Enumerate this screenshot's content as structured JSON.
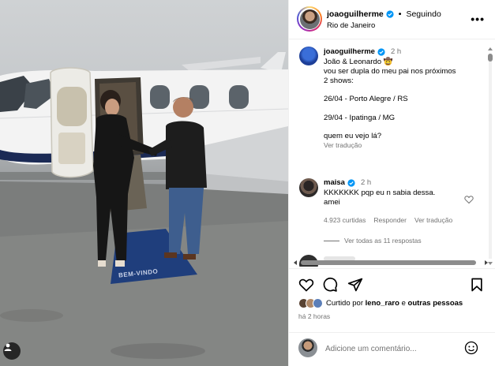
{
  "header": {
    "username": "joaoguilherme",
    "separator": "•",
    "follow_status": "Seguindo",
    "location": "Rio de Janeiro",
    "more": "•••"
  },
  "caption": {
    "username": "joaoguilherme",
    "time": "2 h",
    "lines": [
      "João & Leonardo 🤠",
      "vou ser dupla do meu pai nos próximos",
      "2 shows:",
      "",
      "26/04 - Porto Alegre / RS",
      "",
      "29/04 - Ipatinga / MG",
      "",
      "quem eu vejo lá?"
    ],
    "see_translation": "Ver tradução"
  },
  "comment": {
    "username": "maisa",
    "time": "2 h",
    "text_line1": "KKKKKKK pqp eu n sabia dessa.",
    "text_line2": "amei",
    "likes": "4.923 curtidas",
    "reply": "Responder",
    "see_translation": "Ver tradução",
    "view_replies": "Ver todas as 11 respostas"
  },
  "footer": {
    "liked_by_prefix": "Curtido por",
    "liked_by_user": "leno_raro",
    "liked_by_and": "e",
    "liked_by_others": "outras pessoas",
    "time_ago": "há 2 horas",
    "comment_placeholder": "Adicione um comentário..."
  },
  "photo": {
    "mat_text": "BEM-VINDO"
  },
  "colors": {
    "verified_blue": "#0095f6",
    "muted_text": "#737373",
    "divider": "#efefef",
    "carpet_blue": "#1f3e7c"
  },
  "icons": [
    "verified-icon",
    "more-icon",
    "heart-icon",
    "comment-icon",
    "share-icon",
    "bookmark-icon",
    "emoji-icon",
    "user-tag-icon"
  ]
}
